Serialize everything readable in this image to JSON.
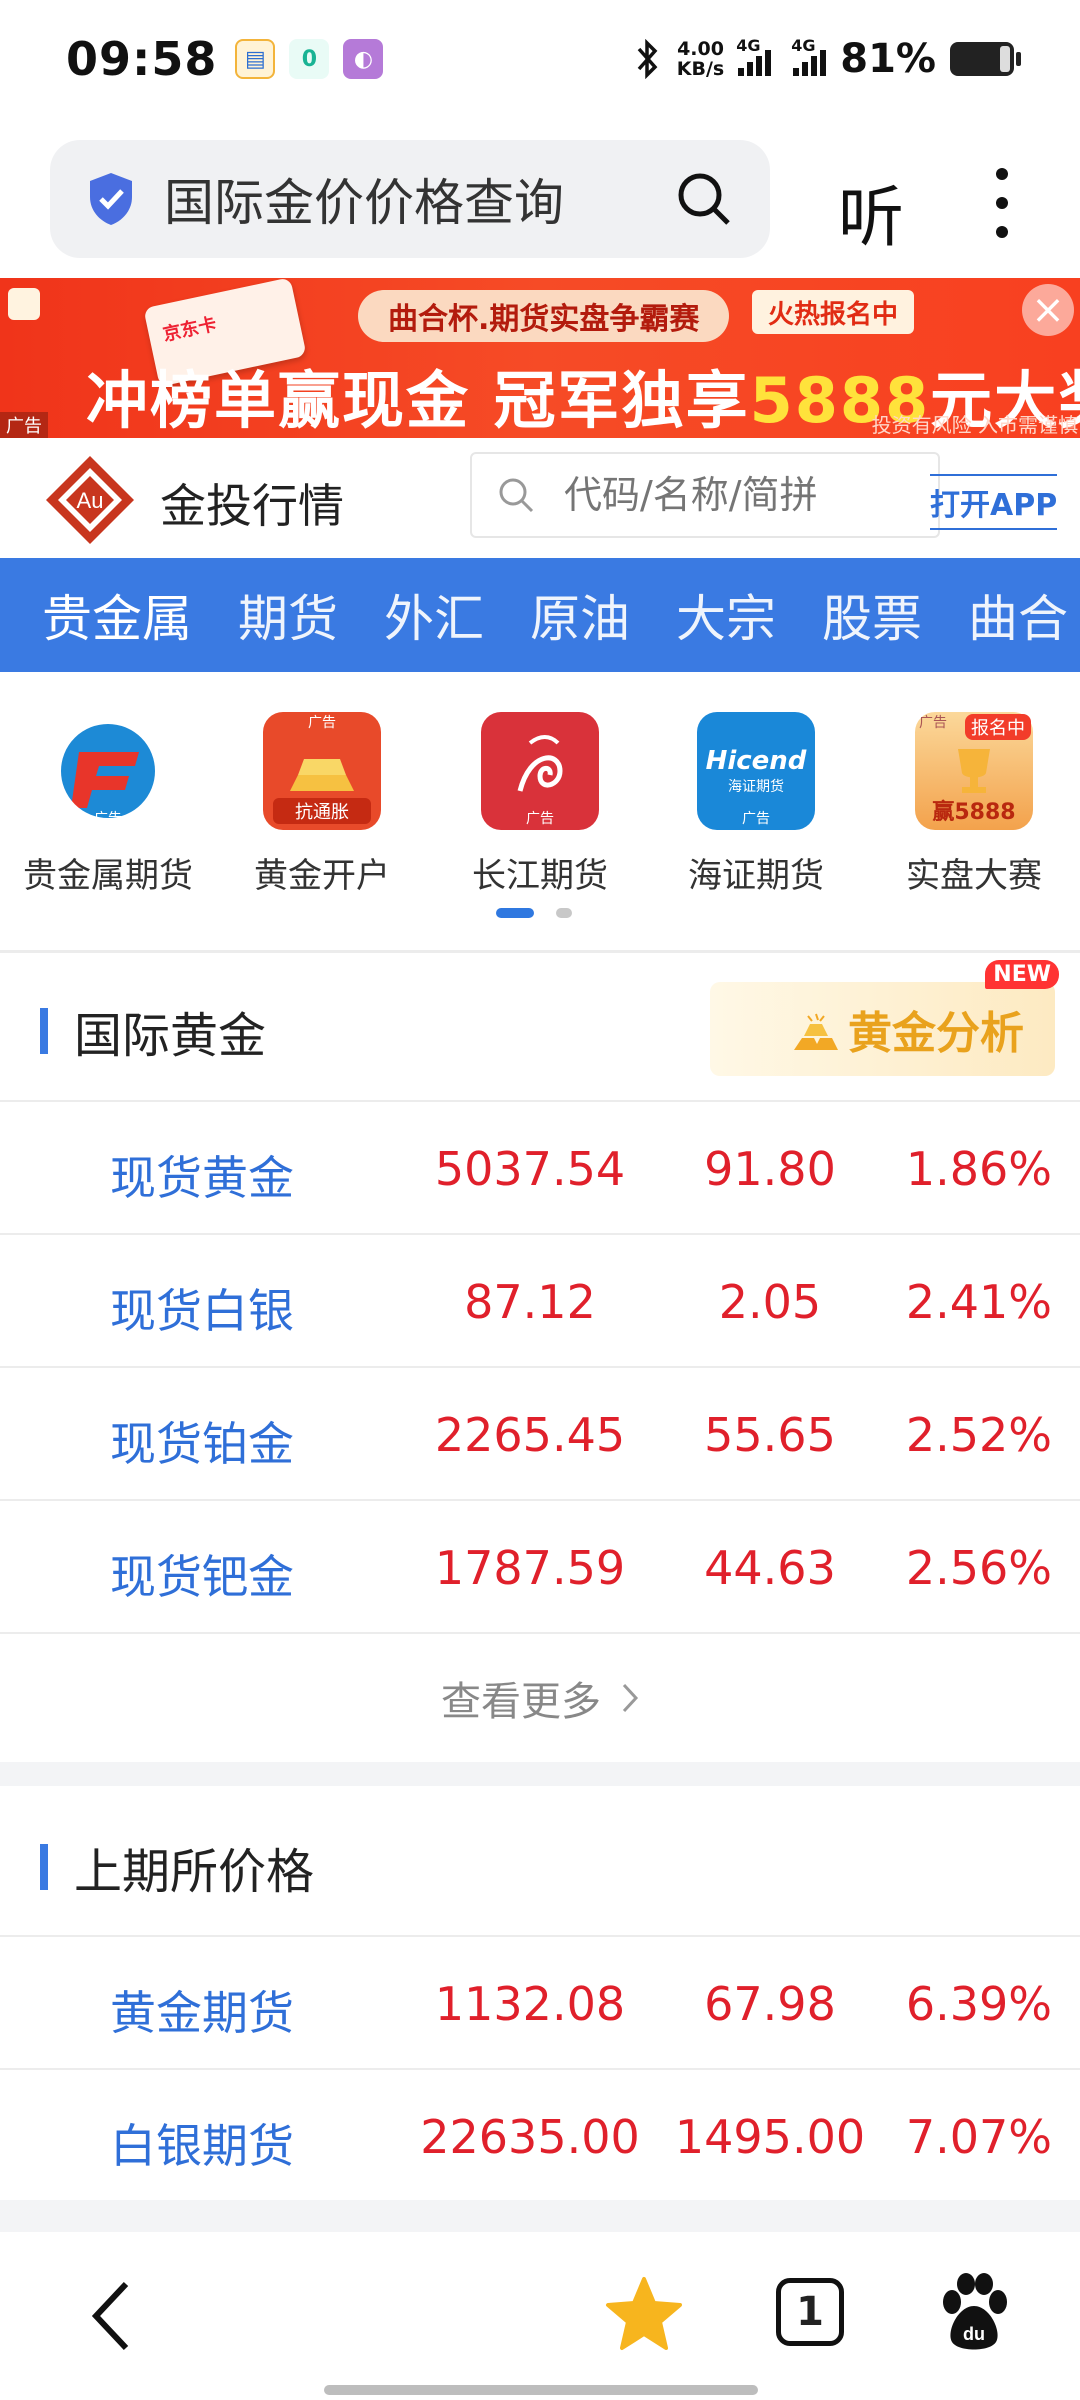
{
  "status_bar": {
    "time": "09:58",
    "net_speed_value": "4.00",
    "net_speed_unit": "KB/s",
    "signal1": "4G",
    "signal2": "4G",
    "battery": "81%"
  },
  "browser": {
    "search_query": "国际金价价格查询",
    "listen_label": "听"
  },
  "banner": {
    "card_text": "京东卡",
    "pill": "曲合杯.期货实盘争霸赛",
    "hot_tag": "火热报名中",
    "headline_part1": "冲榜单赢现金 冠军独享",
    "headline_highlight": "5888",
    "headline_part2": "元大奖",
    "ad_tag": "广告",
    "risk_text": "投资有风险 入市需谨慎"
  },
  "site": {
    "logo_text": "Au",
    "name": "金投行情",
    "search_placeholder": "代码/名称/简拼",
    "open_app": "打开APP"
  },
  "tabs": [
    "贵金属",
    "期货",
    "外汇",
    "原油",
    "大宗",
    "股票",
    "曲合"
  ],
  "quick_links": [
    {
      "label": "贵金属期货",
      "ad": "广告"
    },
    {
      "label": "黄金开户",
      "ad": "广告",
      "badge": "抗通胀"
    },
    {
      "label": "长江期货",
      "ad": "广告"
    },
    {
      "label": "海证期货",
      "ad": "广告",
      "brand": "Hicend",
      "brand_sub": "海证期货"
    },
    {
      "label": "实盘大赛",
      "ad": "广告",
      "badge": "报名中",
      "prize": "赢5888"
    }
  ],
  "international_gold": {
    "title": "国际黄金",
    "analysis_button": "黄金分析",
    "new_badge": "NEW",
    "rows": [
      {
        "name": "现货黄金",
        "price": "5037.54",
        "change": "91.80",
        "pct": "1.86%"
      },
      {
        "name": "现货白银",
        "price": "87.12",
        "change": "2.05",
        "pct": "2.41%"
      },
      {
        "name": "现货铂金",
        "price": "2265.45",
        "change": "55.65",
        "pct": "2.52%"
      },
      {
        "name": "现货钯金",
        "price": "1787.59",
        "change": "44.63",
        "pct": "2.56%"
      }
    ],
    "see_more": "查看更多"
  },
  "shfe": {
    "title": "上期所价格",
    "rows": [
      {
        "name": "黄金期货",
        "price": "1132.08",
        "change": "67.98",
        "pct": "6.39%"
      },
      {
        "name": "白银期货",
        "price": "22635.00",
        "change": "1495.00",
        "pct": "7.07%"
      }
    ]
  },
  "bottom_nav": {
    "tab_count": "1"
  },
  "colors": {
    "accent_blue": "#3a7ae2",
    "up_red": "#e0202b",
    "link_blue": "#2f6fd8",
    "gold": "#e9a21d"
  }
}
